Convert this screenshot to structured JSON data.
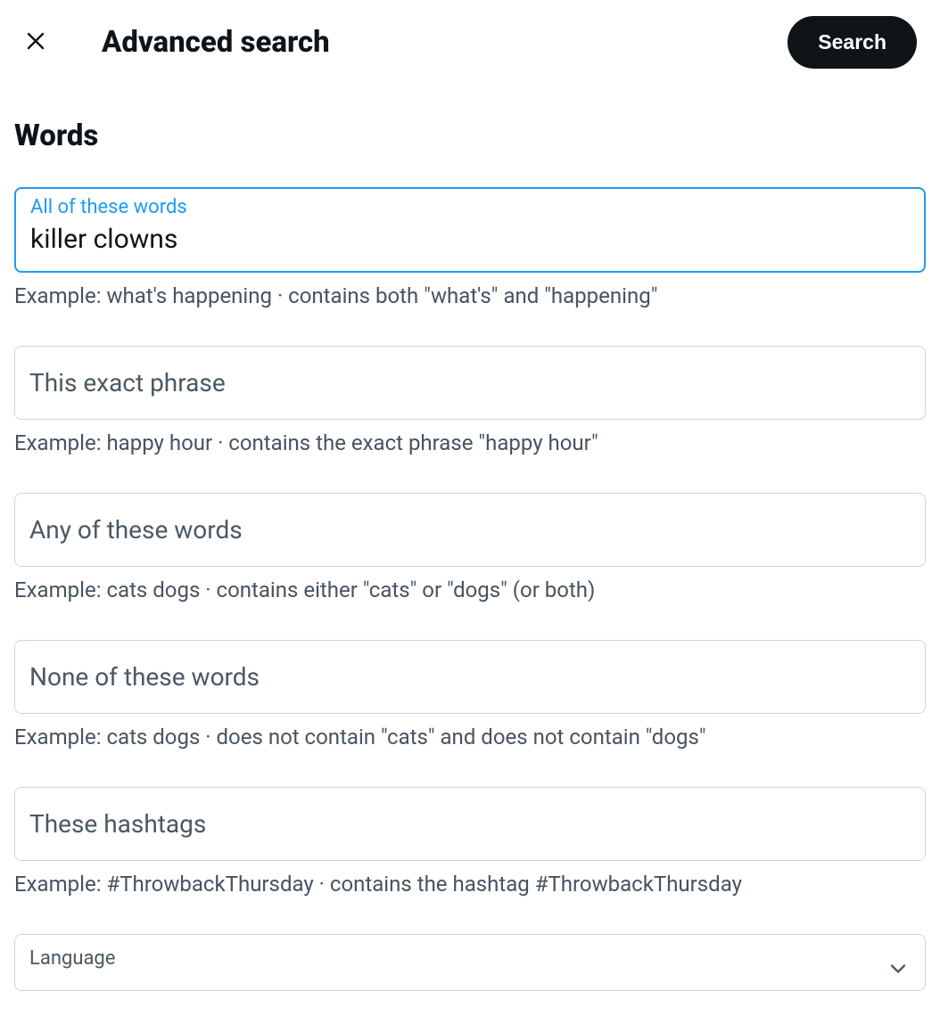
{
  "header": {
    "title": "Advanced search",
    "search_button": "Search"
  },
  "section": {
    "title": "Words"
  },
  "fields": {
    "all_words": {
      "label": "All of these words",
      "value": "killer clowns",
      "help": "Example: what's happening · contains both \"what's\" and \"happening\""
    },
    "exact_phrase": {
      "label": "This exact phrase",
      "help": "Example: happy hour · contains the exact phrase \"happy hour\""
    },
    "any_words": {
      "label": "Any of these words",
      "help": "Example: cats dogs · contains either \"cats\" or \"dogs\" (or both)"
    },
    "none_words": {
      "label": "None of these words",
      "help": "Example: cats dogs · does not contain \"cats\" and does not contain \"dogs\""
    },
    "hashtags": {
      "label": "These hashtags",
      "help": "Example: #ThrowbackThursday · contains the hashtag #ThrowbackThursday"
    },
    "language": {
      "label": "Language"
    }
  }
}
